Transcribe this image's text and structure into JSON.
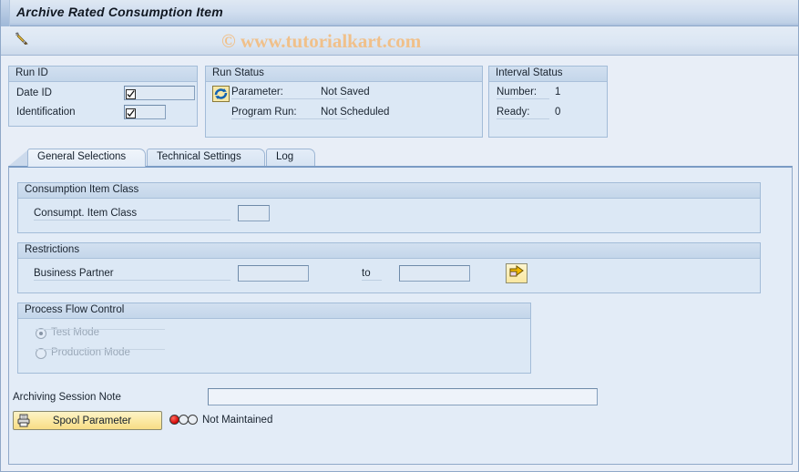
{
  "window": {
    "title": "Archive Rated Consumption Item"
  },
  "watermark": {
    "text": "© www.tutorialkart.com"
  },
  "toolbar": {
    "edit_icon": "pencil-icon"
  },
  "run_id": {
    "legend": "Run ID",
    "fields": [
      {
        "label": "Date ID",
        "value": "",
        "icon": "checkbox-checked-icon"
      },
      {
        "label": "Identification",
        "value": "",
        "icon": "checkbox-checked-icon"
      }
    ]
  },
  "run_status": {
    "legend": "Run Status",
    "refresh_icon": "refresh-icon",
    "rows": [
      {
        "label": "Parameter:",
        "value": "Not Saved"
      },
      {
        "label": "Program Run:",
        "value": "Not Scheduled"
      }
    ]
  },
  "interval_status": {
    "legend": "Interval Status",
    "rows": [
      {
        "label": "Number:",
        "value": "1"
      },
      {
        "label": "Ready:",
        "value": "0"
      }
    ]
  },
  "tabs": [
    {
      "label": "General Selections",
      "active": true
    },
    {
      "label": "Technical Settings",
      "active": false
    },
    {
      "label": "Log",
      "active": false
    }
  ],
  "consumption_item_class": {
    "legend": "Consumption Item Class",
    "field_label": "Consumpt. Item Class",
    "field_value": ""
  },
  "restrictions": {
    "legend": "Restrictions",
    "field_label": "Business Partner",
    "from_value": "",
    "to_label": "to",
    "to_value": "",
    "multi_select_icon": "multiple-selection-arrow-icon"
  },
  "process_flow_control": {
    "legend": "Process Flow Control",
    "options": [
      {
        "label": "Test Mode",
        "selected": true,
        "disabled": true
      },
      {
        "label": "Production Mode",
        "selected": false,
        "disabled": true
      }
    ]
  },
  "footer": {
    "note_label": "Archiving Session Note",
    "note_value": "",
    "spool_button_label": "Spool Parameter",
    "spool_button_icon": "printer-icon",
    "spool_status_text": "Not Maintained",
    "spool_status_icon": "traffic-light-red-icon"
  },
  "colors": {
    "title_text": "#111822",
    "body_bg": "#e8eef7",
    "group_bg": "#dce8f5",
    "group_border": "#a3bcd8",
    "watermark": "#f0c08a",
    "button_yellow": "#fbe9a4",
    "status_red": "#d10000",
    "disabled_text": "#9aa8b8"
  }
}
